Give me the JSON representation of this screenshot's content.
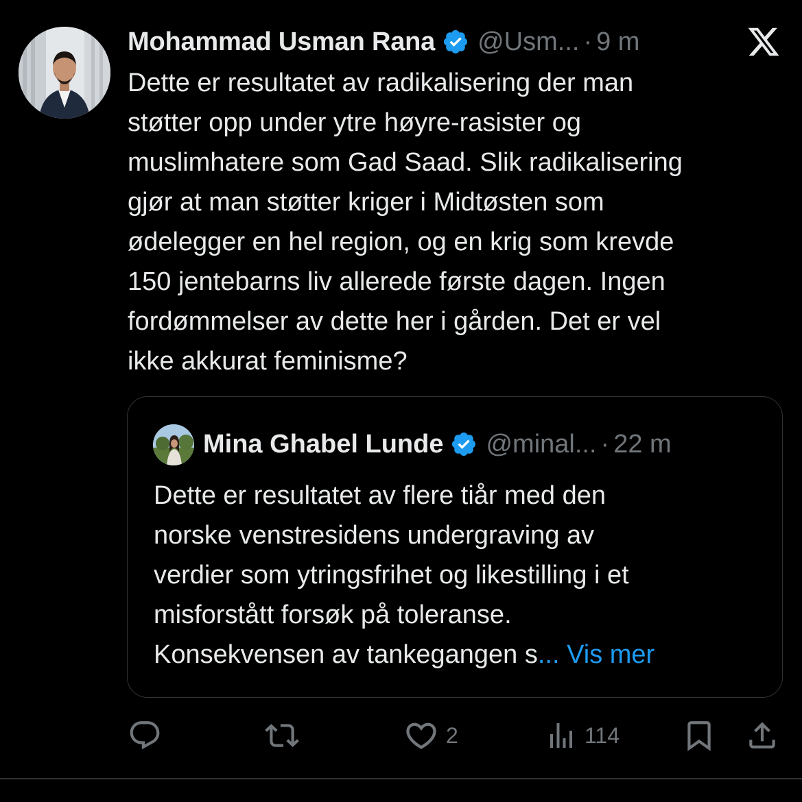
{
  "tweet": {
    "display_name": "Mohammad Usman Rana",
    "handle": "@Usm...",
    "separator": "·",
    "time": "9 m",
    "text": "Dette er resultatet av radikalisering der man\nstøtter opp under ytre høyre-rasister og\nmuslimhatere som Gad Saad. Slik radikalisering\ngjør at man støtter kriger i Midtøsten som\nødelegger en hel region, og en krig som krevde\n150 jentebarns liv allerede første dagen. Ingen\nfordømmelser av dette her i gården. Det er vel\nikke akkurat feminisme?",
    "stats": {
      "likes": "2",
      "views": "114"
    }
  },
  "quoted_tweet": {
    "display_name": "Mina Ghabel Lunde",
    "handle": "@minal...",
    "separator": "·",
    "time": "22 m",
    "text": "Dette er resultatet av flere tiår med den\nnorske venstresidens undergraving av\nverdier som ytringsfrihet og likestilling i et\nmisforstått forsøk på toleranse.\nKonsekvensen av tankegangen s",
    "ellipsis": "... ",
    "show_more": "Vis mer"
  },
  "icons": {
    "verified": "verified-badge-icon",
    "platform": "x-logo-icon",
    "reply": "reply-icon",
    "repost": "repost-icon",
    "like": "heart-icon",
    "views": "views-icon",
    "bookmark": "bookmark-icon",
    "share": "share-icon"
  },
  "colors": {
    "background": "#000000",
    "text": "#e7e9ea",
    "secondary": "#71767b",
    "accent": "#1d9bf0",
    "border": "#2f3336"
  }
}
